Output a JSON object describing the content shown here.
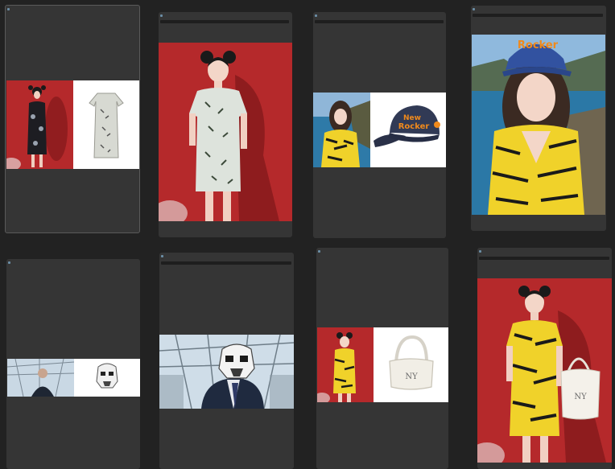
{
  "canvas": {
    "background": "#222222"
  },
  "colors": {
    "node": "#353535",
    "titlebar": "#1e1e1e",
    "studio_red": "#b5292b",
    "product_bg": "#ffffff",
    "yellow_dress": "#f0d22a"
  },
  "nodes": [
    {
      "id": "compare-qipao-bamboo",
      "images": [
        "model-black-qipao",
        "product-bamboo-qipao"
      ]
    },
    {
      "id": "output-bamboo-qipao",
      "images": [
        "model-white-bamboo-qipao"
      ]
    },
    {
      "id": "compare-cap",
      "images": [
        "model-yellow-dress-coast",
        "product-navy-cap"
      ]
    },
    {
      "id": "output-cap",
      "images": [
        "model-yellow-dress-cap"
      ]
    },
    {
      "id": "compare-trooper",
      "images": [
        "man-in-suit-greenhouse",
        "product-trooper-helmet"
      ]
    },
    {
      "id": "output-trooper",
      "images": [
        "suit-trooper-helmet"
      ]
    },
    {
      "id": "compare-bag",
      "images": [
        "model-yellow-qipao",
        "product-white-bag"
      ]
    },
    {
      "id": "output-bag",
      "images": [
        "model-yellow-qipao-bag"
      ]
    }
  ],
  "cap_text": {
    "line1": "New",
    "line2": "Rocker",
    "line3": "New"
  },
  "bag_logo": "NY"
}
